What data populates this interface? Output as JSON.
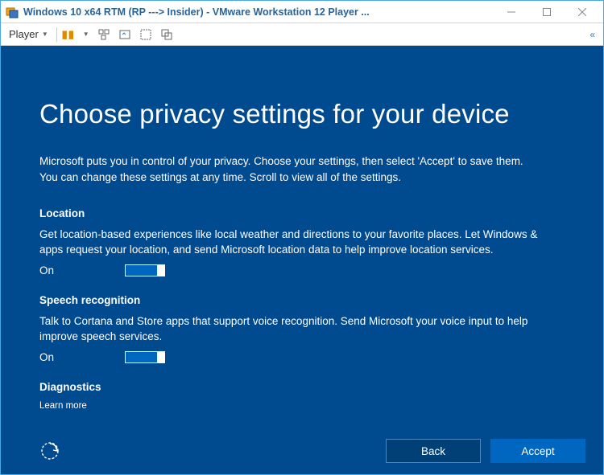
{
  "window": {
    "title": "Windows 10 x64 RTM (RP ---> Insider) - VMware Workstation 12 Player ..."
  },
  "toolbar": {
    "player_label": "Player"
  },
  "privacy": {
    "heading": "Choose privacy settings for your device",
    "intro": "Microsoft puts you in control of your privacy. Choose your settings, then select 'Accept' to save them. You can change these settings at any time. Scroll to view all of the settings.",
    "sections": [
      {
        "title": "Location",
        "desc": "Get location-based experiences like local weather and directions to your favorite places. Let Windows & apps request your location, and send Microsoft location data to help improve location services.",
        "state_label": "On"
      },
      {
        "title": "Speech recognition",
        "desc": "Talk to Cortana and Store apps that support voice recognition. Send Microsoft your voice input to help improve speech services.",
        "state_label": "On"
      },
      {
        "title": "Diagnostics",
        "desc": "",
        "state_label": ""
      }
    ],
    "learn_more": "Learn more",
    "back_label": "Back",
    "accept_label": "Accept"
  }
}
